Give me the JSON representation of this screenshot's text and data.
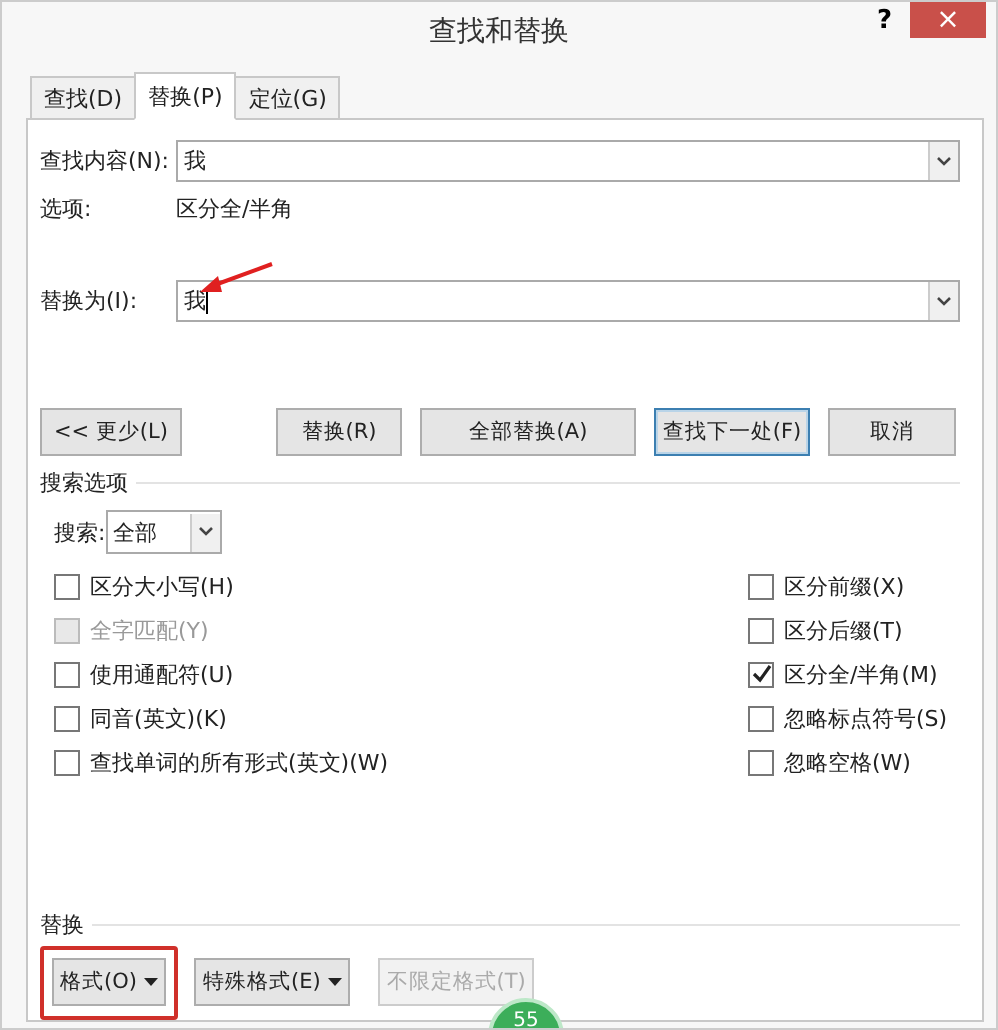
{
  "window": {
    "title": "查找和替换",
    "help": "?",
    "close": "×"
  },
  "tabs": [
    {
      "label": "查找(D)",
      "selected": false
    },
    {
      "label": "替换(P)",
      "selected": true
    },
    {
      "label": "定位(G)",
      "selected": false
    }
  ],
  "find": {
    "label": "查找内容(N):",
    "value": "我",
    "options_label": "选项:",
    "options_value": "区分全/半角"
  },
  "replace": {
    "label": "替换为(I):",
    "value": "我"
  },
  "more_button": "<< 更少(L)",
  "buttons": [
    {
      "label": "替换(R)",
      "selected": false
    },
    {
      "label": "全部替换(A)",
      "selected": false
    },
    {
      "label": "查找下一处(F)",
      "selected": true
    },
    {
      "label": "取消",
      "selected": false
    }
  ],
  "search_options": {
    "heading": "搜索选项",
    "search_label": "搜索:",
    "search_value": "全部"
  },
  "checkboxes_left": [
    {
      "label": "区分大小写(H)",
      "checked": false,
      "disabled": false
    },
    {
      "label": "全字匹配(Y)",
      "checked": false,
      "disabled": true
    },
    {
      "label": "使用通配符(U)",
      "checked": false,
      "disabled": false
    },
    {
      "label": "同音(英文)(K)",
      "checked": false,
      "disabled": false
    },
    {
      "label": "查找单词的所有形式(英文)(W)",
      "checked": false,
      "disabled": false
    }
  ],
  "checkboxes_right": [
    {
      "label": "区分前缀(X)",
      "checked": false,
      "disabled": false
    },
    {
      "label": "区分后缀(T)",
      "checked": false,
      "disabled": false
    },
    {
      "label": "区分全/半角(M)",
      "checked": true,
      "disabled": false
    },
    {
      "label": "忽略标点符号(S)",
      "checked": false,
      "disabled": false
    },
    {
      "label": "忽略空格(W)",
      "checked": false,
      "disabled": false
    }
  ],
  "replace_section": {
    "heading": "替换"
  },
  "format_buttons": [
    {
      "label": "格式(O)",
      "dropdown": true,
      "disabled": false,
      "highlighted": true
    },
    {
      "label": "特殊格式(E)",
      "dropdown": true,
      "disabled": false,
      "highlighted": false
    },
    {
      "label": "不限定格式(T)",
      "dropdown": false,
      "disabled": true,
      "highlighted": false
    }
  ],
  "badge": "55"
}
